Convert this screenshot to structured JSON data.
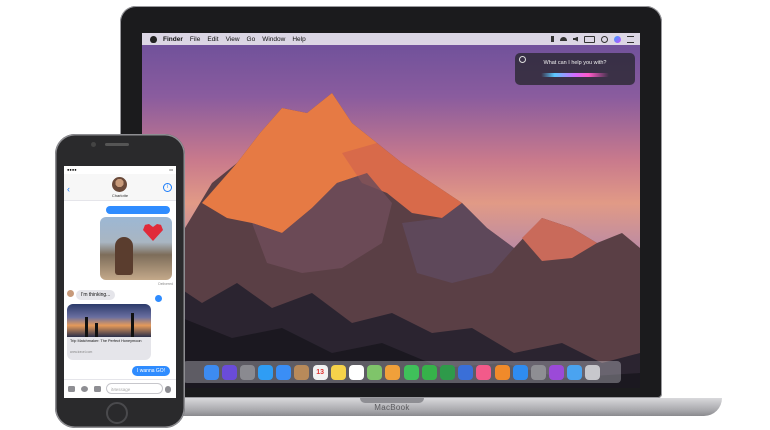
{
  "mac": {
    "label": "MacBook",
    "menubar": {
      "items": [
        "Finder",
        "File",
        "Edit",
        "View",
        "Go",
        "Window",
        "Help"
      ]
    },
    "siri": {
      "prompt": "What can I help you with?"
    },
    "dock": {
      "apps": [
        {
          "name": "finder-app",
          "color": "#3d8bf0",
          "glyph": ""
        },
        {
          "name": "siri-app",
          "color": "#6a4cd9",
          "glyph": ""
        },
        {
          "name": "launchpad-app",
          "color": "#8a8a90",
          "glyph": ""
        },
        {
          "name": "safari-app",
          "color": "#2f9df4",
          "glyph": ""
        },
        {
          "name": "mail-app",
          "color": "#3a8ef6",
          "glyph": ""
        },
        {
          "name": "contacts-app",
          "color": "#b88a5a",
          "glyph": ""
        },
        {
          "name": "calendar-app",
          "color": "#f2f2f2",
          "glyph": "13"
        },
        {
          "name": "notes-app",
          "color": "#f6d24a",
          "glyph": ""
        },
        {
          "name": "reminders-app",
          "color": "#ffffff",
          "glyph": ""
        },
        {
          "name": "maps-app",
          "color": "#7fc46a",
          "glyph": ""
        },
        {
          "name": "photos-app",
          "color": "#f0a03a",
          "glyph": ""
        },
        {
          "name": "messages-app",
          "color": "#3fc15a",
          "glyph": ""
        },
        {
          "name": "facetime-app",
          "color": "#36b24a",
          "glyph": ""
        },
        {
          "name": "numbers-app",
          "color": "#2e9a4a",
          "glyph": ""
        },
        {
          "name": "keynote-app",
          "color": "#3a6fd8",
          "glyph": ""
        },
        {
          "name": "itunes-app",
          "color": "#f25a8a",
          "glyph": ""
        },
        {
          "name": "ibooks-app",
          "color": "#f08a2a",
          "glyph": ""
        },
        {
          "name": "app-store-app",
          "color": "#2f8cf0",
          "glyph": ""
        },
        {
          "name": "system-preferences-app",
          "color": "#8e8e93",
          "glyph": ""
        },
        {
          "name": "podcast-app",
          "color": "#9b4ad8",
          "glyph": ""
        },
        {
          "name": "downloads-folder",
          "color": "#4aa3f0",
          "glyph": ""
        },
        {
          "name": "trash-app",
          "color": "#c7c7cc",
          "glyph": ""
        }
      ]
    }
  },
  "phone": {
    "contact_name": "Charlotte",
    "messages": {
      "thinking": "I'm thinking...",
      "reply": "I wanna GO!",
      "read_by": "Delivered"
    },
    "link": {
      "title": "Trip Matchmaker: The Perfect Honeymoon",
      "url": "www.travel.com"
    },
    "input_placeholder": "iMessage"
  }
}
